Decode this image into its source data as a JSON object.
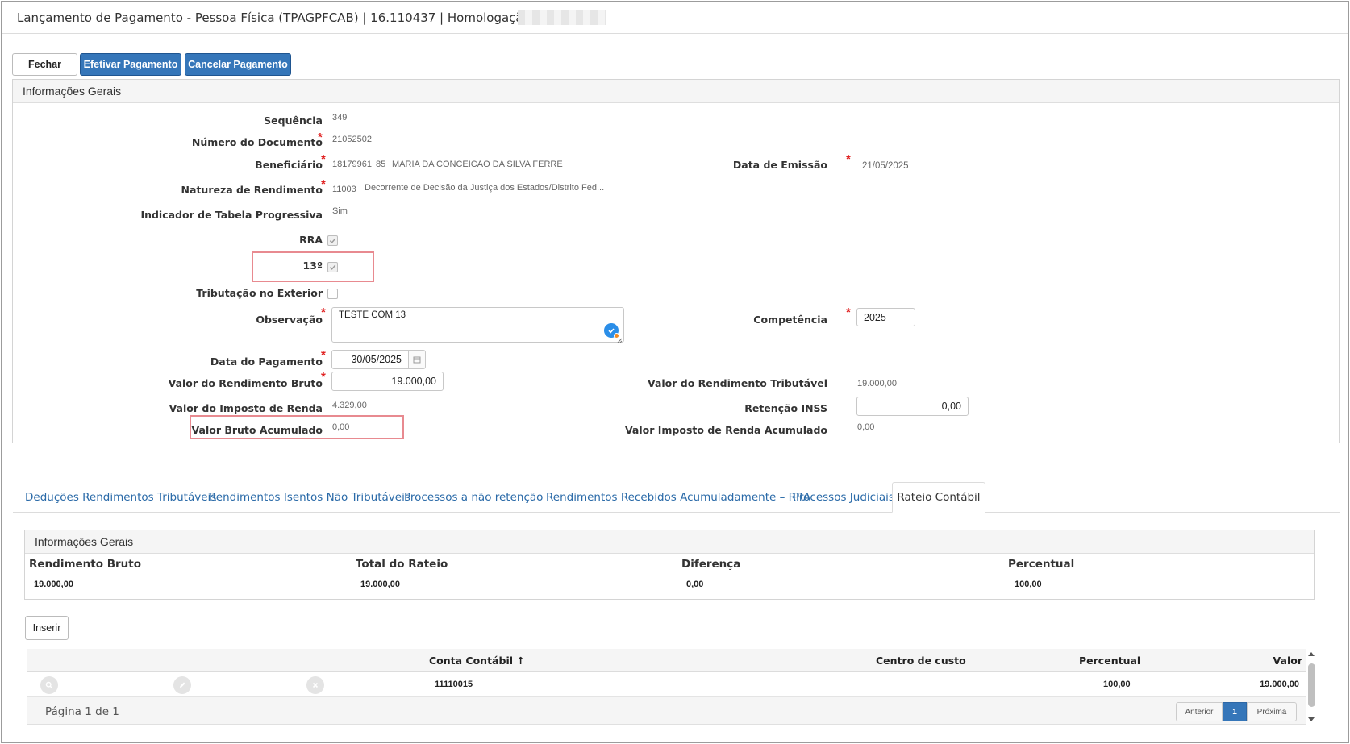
{
  "window": {
    "title": "Lançamento de Pagamento - Pessoa Física (TPAGPFCAB) | 16.110437 | Homologação |"
  },
  "toolbar": {
    "fechar": "Fechar",
    "efetivar": "Efetivar Pagamento",
    "cancelar": "Cancelar Pagamento"
  },
  "info_panel": {
    "heading": "Informações Gerais",
    "sequencia": {
      "label": "Sequência",
      "value": "349"
    },
    "numero_documento": {
      "label": "Número do Documento",
      "value": "21052502"
    },
    "beneficiario": {
      "label": "Beneficiário",
      "code": "18179961",
      "seq": "85",
      "name": "MARIA DA CONCEICAO DA SILVA FERRE"
    },
    "data_emissao": {
      "label": "Data de Emissão",
      "value": "21/05/2025"
    },
    "natureza": {
      "label": "Natureza de Rendimento",
      "code": "11003",
      "desc": "Decorrente de Decisão da Justiça dos Estados/Distrito Fed..."
    },
    "indicador_tabela": {
      "label": "Indicador de Tabela Progressiva",
      "value": "Sim"
    },
    "rra": {
      "label": "RRA",
      "checked": true
    },
    "decimo_terceiro": {
      "label": "13º",
      "checked": true
    },
    "tributacao_exterior": {
      "label": "Tributação no Exterior",
      "checked": false
    },
    "observacao": {
      "label": "Observação",
      "value": "TESTE COM 13"
    },
    "competencia": {
      "label": "Competência",
      "value": "2025"
    },
    "data_pagamento": {
      "label": "Data do Pagamento",
      "value": "30/05/2025"
    },
    "valor_rendimento_bruto": {
      "label": "Valor do Rendimento Bruto",
      "value": "19.000,00"
    },
    "valor_rendimento_tributavel": {
      "label": "Valor do Rendimento Tributável",
      "value": "19.000,00"
    },
    "valor_imposto_renda": {
      "label": "Valor do Imposto de Renda",
      "value": "4.329,00"
    },
    "retencao_inss": {
      "label": "Retenção INSS",
      "value": "0,00"
    },
    "valor_bruto_acumulado": {
      "label": "Valor Bruto Acumulado",
      "value": "0,00"
    },
    "valor_imposto_acumulado": {
      "label": "Valor Imposto de Renda Acumulado",
      "value": "0,00"
    }
  },
  "tabs": [
    {
      "label": "Deduções Rendimentos Tributáveis"
    },
    {
      "label": "Rendimentos Isentos Não Tributáveis"
    },
    {
      "label": "Processos a não retenção"
    },
    {
      "label": "Rendimentos Recebidos Acumuladamente – RRA"
    },
    {
      "label": "Processos Judiciais"
    },
    {
      "label": "Rateio Contábil"
    }
  ],
  "rateio": {
    "heading": "Informações Gerais",
    "rendimento_bruto": {
      "label": "Rendimento Bruto",
      "value": "19.000,00"
    },
    "total_rateio": {
      "label": "Total do Rateio",
      "value": "19.000,00"
    },
    "diferenca": {
      "label": "Diferença",
      "value": "0,00"
    },
    "percentual": {
      "label": "Percentual",
      "value": "100,00"
    },
    "inserir": "Inserir",
    "grid": {
      "columns": {
        "conta": "Conta Contábil",
        "sort_arrow": "↑",
        "centro": "Centro de custo",
        "percentual": "Percentual",
        "valor": "Valor"
      },
      "rows": [
        {
          "conta": "11110015",
          "centro": "",
          "percentual": "100,00",
          "valor": "19.000,00"
        }
      ],
      "page_info": "Página 1 de 1",
      "pager": {
        "anterior": "Anterior",
        "current": "1",
        "proxima": "Próxima"
      }
    }
  },
  "colors": {
    "primary": "#3576b9",
    "link": "#2a6aa8",
    "highlight": "#e88a90",
    "required": "#e02020"
  }
}
